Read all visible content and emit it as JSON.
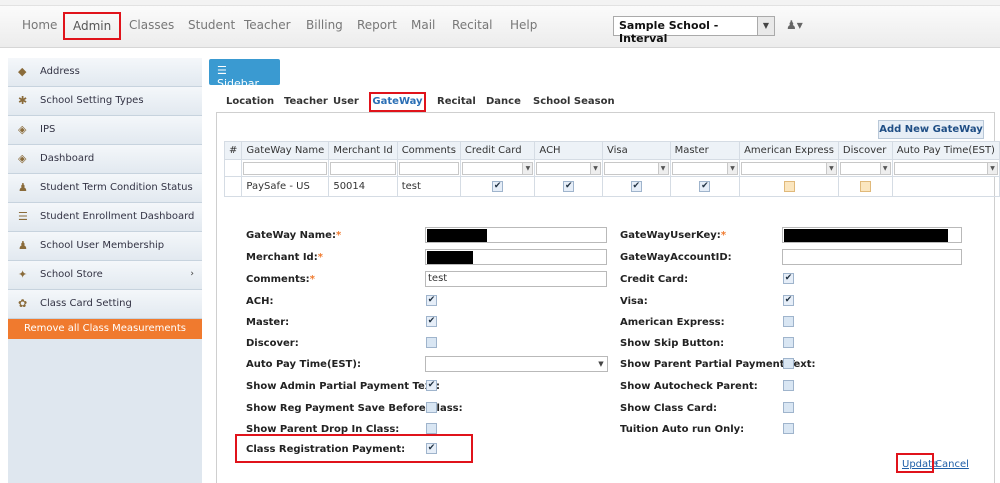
{
  "nav": {
    "items": [
      "Home",
      "Admin",
      "Classes",
      "Student",
      "Teacher",
      "Billing",
      "Report",
      "Mail",
      "Recital",
      "Help"
    ],
    "school_select": "Sample School - Interval"
  },
  "sidebar": {
    "toggle_label": "Sidebar",
    "items": [
      {
        "label": "Address",
        "icon": "map-pin-icon"
      },
      {
        "label": "School Setting Types",
        "icon": "settings-icon"
      },
      {
        "label": "IPS",
        "icon": "network-icon"
      },
      {
        "label": "Dashboard",
        "icon": "dashboard-icon"
      },
      {
        "label": "Student Term Condition Status",
        "icon": "student-icon"
      },
      {
        "label": "Student Enrollment Dashboard",
        "icon": "list-icon"
      },
      {
        "label": "School User Membership",
        "icon": "users-icon"
      },
      {
        "label": "School Store",
        "icon": "store-icon"
      },
      {
        "label": "Class Card Setting",
        "icon": "card-icon"
      }
    ],
    "remove_button": "Remove all Class Measurements"
  },
  "tabs": [
    "Location",
    "Teacher",
    "User",
    "GateWay",
    "Recital",
    "Dance",
    "School Season"
  ],
  "grid": {
    "add_button": "Add New GateWay",
    "columns": [
      "#",
      "GateWay Name",
      "Merchant Id",
      "Comments",
      "Credit Card",
      "ACH",
      "Visa",
      "Master",
      "American Express",
      "Discover",
      "Auto Pay Time(EST)"
    ],
    "row": {
      "name": "PaySafe - US",
      "merchant_id": "50014",
      "comments": "test"
    }
  },
  "form": {
    "left": [
      {
        "label": "GateWay Name:",
        "req": "*"
      },
      {
        "label": "Merchant Id:",
        "req": "*"
      },
      {
        "label": "Comments:",
        "req": "*"
      },
      {
        "label": "ACH:"
      },
      {
        "label": "Master:"
      },
      {
        "label": "Discover:"
      },
      {
        "label": "Auto Pay Time(EST):"
      },
      {
        "label": "Show Admin Partial Payment Text:"
      },
      {
        "label": "Show Reg Payment Save Before Class:"
      },
      {
        "label": "Show Parent Drop In Class:"
      },
      {
        "label": "Class Registration Payment:"
      }
    ],
    "right": [
      {
        "label": "GateWayUserKey:",
        "req": "*"
      },
      {
        "label": "GateWayAccountID:"
      },
      {
        "label": "Credit Card:"
      },
      {
        "label": "Visa:"
      },
      {
        "label": "American Express:"
      },
      {
        "label": "Show Skip Button:"
      },
      {
        "label": "Show Parent Partial Payment Text:"
      },
      {
        "label": "Show Autocheck Parent:"
      },
      {
        "label": "Show Class Card:"
      },
      {
        "label": "Tuition Auto run Only:"
      }
    ],
    "comments_value": "test",
    "update_label": "Update",
    "cancel_label": "Cancel"
  }
}
